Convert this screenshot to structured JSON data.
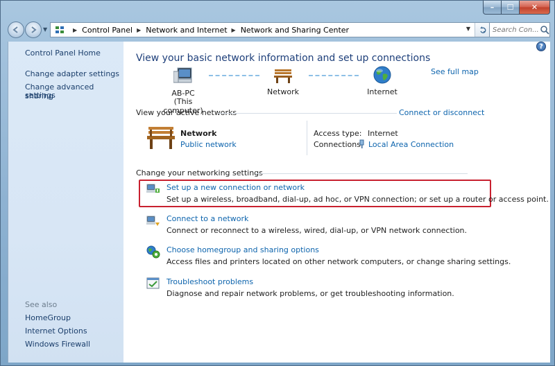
{
  "window": {
    "minimize": "–",
    "maximize": "☐",
    "close": "✕"
  },
  "address_bar": {
    "breadcrumbs": [
      "Control Panel",
      "Network and Internet",
      "Network and Sharing Center"
    ],
    "search_placeholder": "Search Con..."
  },
  "sidebar": {
    "home": "Control Panel Home",
    "links": [
      "Change adapter settings",
      "Change advanced sharing",
      "settings"
    ],
    "see_also_label": "See also",
    "see_also": [
      "HomeGroup",
      "Internet Options",
      "Windows Firewall"
    ]
  },
  "main": {
    "title": "View your basic network information and set up connections",
    "see_full_map": "See full map",
    "map": {
      "computer_line1": "AB-PC",
      "computer_line2": "(This computer)",
      "network": "Network",
      "internet": "Internet"
    },
    "active_networks_label": "View your active networks",
    "connect_or_disconnect": "Connect or disconnect",
    "active_network": {
      "name": "Network",
      "type": "Public network",
      "access_type_label": "Access type:",
      "access_type_value": "Internet",
      "connections_label": "Connections:",
      "connections_value": "Local Area Connection"
    },
    "change_settings_label": "Change your networking settings",
    "tasks": [
      {
        "title": "Set up a new connection or network",
        "desc": "Set up a wireless, broadband, dial-up, ad hoc, or VPN connection; or set up a router or access point."
      },
      {
        "title": "Connect to a network",
        "desc": "Connect or reconnect to a wireless, wired, dial-up, or VPN network connection."
      },
      {
        "title": "Choose homegroup and sharing options",
        "desc": "Access files and printers located on other network computers, or change sharing settings."
      },
      {
        "title": "Troubleshoot problems",
        "desc": "Diagnose and repair network problems, or get troubleshooting information."
      }
    ]
  },
  "colors": {
    "link": "#0d64ad",
    "heading": "#1e3f7a",
    "highlight_border": "#c8202f",
    "sidebar_bg": "#d8e6f5"
  }
}
